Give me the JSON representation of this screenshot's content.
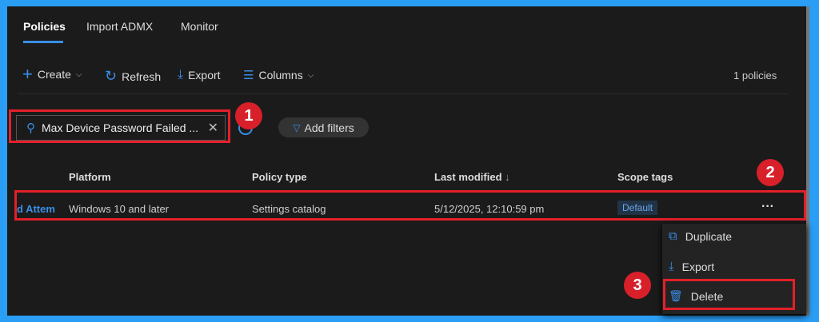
{
  "tabs": [
    {
      "label": "Policies",
      "active": true
    },
    {
      "label": "Import ADMX"
    },
    {
      "label": "Monitor"
    }
  ],
  "toolbar": {
    "create": "Create",
    "refresh": "Refresh",
    "export": "Export",
    "columns": "Columns",
    "count": "1 policies"
  },
  "search": {
    "value": "Max Device Password Failed ..."
  },
  "filters": {
    "add": "Add filters"
  },
  "table": {
    "headers": [
      "Platform",
      "Policy type",
      "Last modified",
      "Scope tags"
    ],
    "rows": [
      {
        "name": "d Attem",
        "platform": "Windows 10 and later",
        "policy_type": "Settings catalog",
        "last_modified": "5/12/2025, 12:10:59 pm",
        "scope_tag": "Default",
        "more": "···"
      }
    ]
  },
  "menu": {
    "items": [
      "Duplicate",
      "Export",
      "Delete"
    ]
  },
  "annotations": [
    "1",
    "2",
    "3"
  ],
  "colors": {
    "accent": "#3a8ee6",
    "highlight": "#e3202a",
    "frame": "#2a9df4"
  }
}
